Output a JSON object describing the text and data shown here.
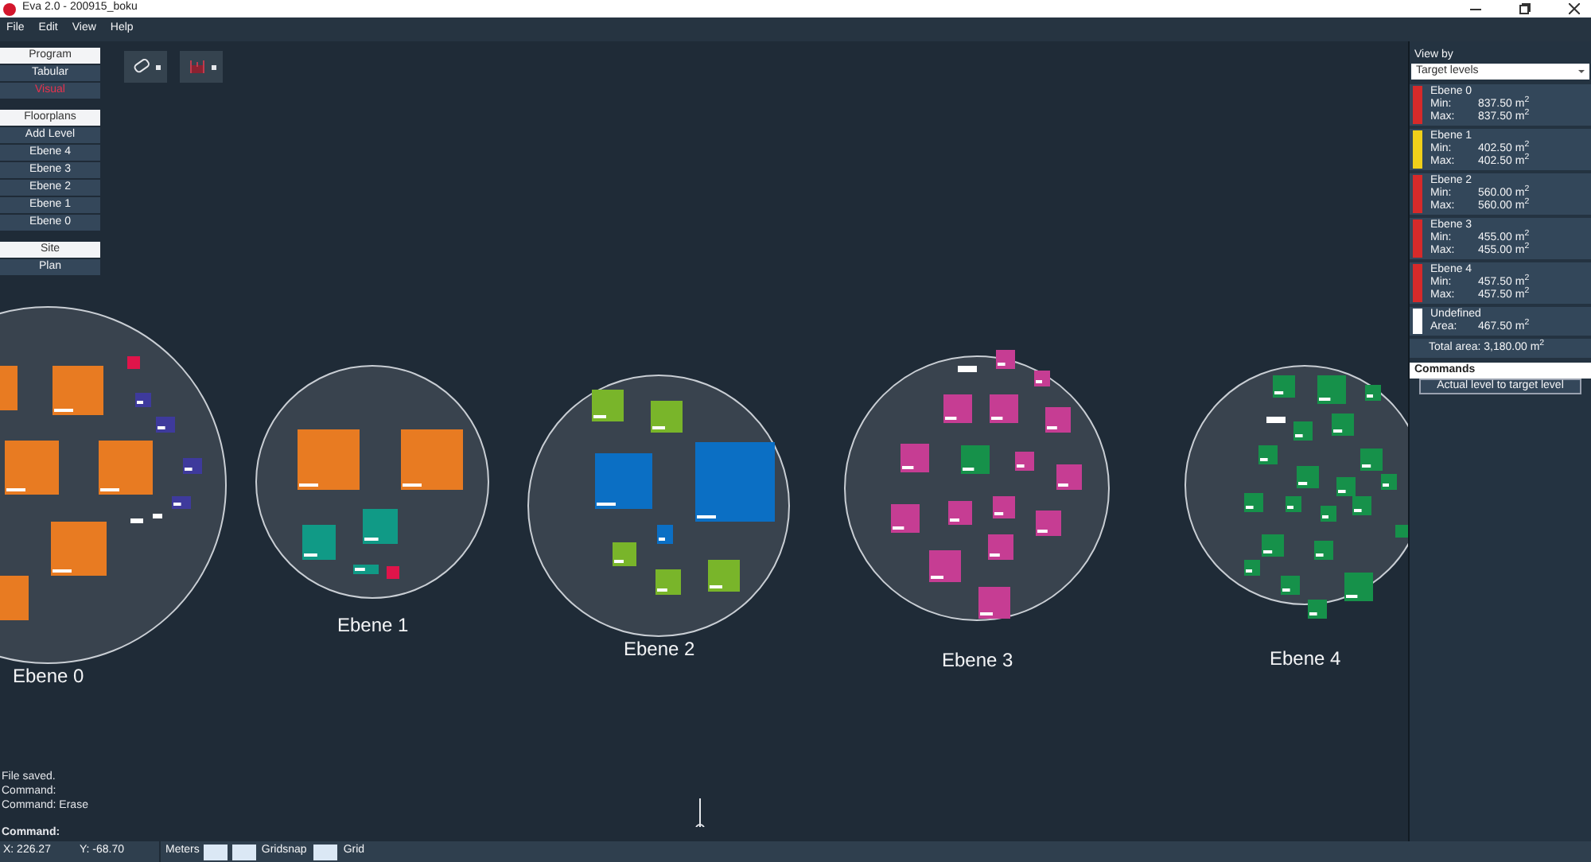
{
  "window": {
    "title": "Eva 2.0 - 200915_boku"
  },
  "menu": [
    "File",
    "Edit",
    "View",
    "Help"
  ],
  "left_panel": {
    "sections": [
      {
        "title": "Program",
        "items": [
          {
            "label": "Tabular",
            "selected": false
          },
          {
            "label": "Visual",
            "selected": true
          }
        ]
      },
      {
        "title": "Floorplans",
        "items": [
          {
            "label": "Add Level",
            "selected": false
          },
          {
            "label": "Ebene 4",
            "selected": false
          },
          {
            "label": "Ebene 3",
            "selected": false
          },
          {
            "label": "Ebene 2",
            "selected": false
          },
          {
            "label": "Ebene 1",
            "selected": false
          },
          {
            "label": "Ebene 0",
            "selected": false
          }
        ]
      },
      {
        "title": "Site",
        "items": [
          {
            "label": "Plan",
            "selected": false
          }
        ]
      }
    ]
  },
  "canvas": {
    "levels": [
      {
        "name": "Ebene 0"
      },
      {
        "name": "Ebene 1"
      },
      {
        "name": "Ebene 2"
      },
      {
        "name": "Ebene 3"
      },
      {
        "name": "Ebene 4"
      }
    ]
  },
  "log": [
    "File saved.",
    "Command:",
    "Command: Erase"
  ],
  "command_prompt": "Command:",
  "right_panel": {
    "view_by_label": "View by",
    "view_by_value": "Target levels",
    "levels": [
      {
        "name": "Ebene 0",
        "color": "#d62a2a",
        "rows": [
          {
            "label": "Min:",
            "value": "837.50 m$^{2}$"
          },
          {
            "label": "Max:",
            "value": "837.50 m$^{2}$"
          }
        ]
      },
      {
        "name": "Ebene 1",
        "color": "#f0d01a",
        "rows": [
          {
            "label": "Min:",
            "value": "402.50 m$^{2}$"
          },
          {
            "label": "Max:",
            "value": "402.50 m$^{2}$"
          }
        ]
      },
      {
        "name": "Ebene 2",
        "color": "#d62a2a",
        "rows": [
          {
            "label": "Min:",
            "value": "560.00 m$^{2}$"
          },
          {
            "label": "Max:",
            "value": "560.00 m$^{2}$"
          }
        ]
      },
      {
        "name": "Ebene 3",
        "color": "#d62a2a",
        "rows": [
          {
            "label": "Min:",
            "value": "455.00 m$^{2}$"
          },
          {
            "label": "Max:",
            "value": "455.00 m$^{2}$"
          }
        ]
      },
      {
        "name": "Ebene 4",
        "color": "#d62a2a",
        "rows": [
          {
            "label": "Min:",
            "value": "457.50 m$^{2}$"
          },
          {
            "label": "Max:",
            "value": "457.50 m$^{2}$"
          }
        ]
      },
      {
        "name": "Undefined",
        "color": "#ffffff",
        "rows": [
          {
            "label": "Area:",
            "value": "467.50 m$^{2}$"
          }
        ]
      }
    ],
    "total": "Total area:  3,180.00 m$^{2}$",
    "commands_label": "Commands",
    "command_button": "Actual level to target level"
  },
  "status_bar": {
    "x": "X:  226.27",
    "y": "Y:  -68.70",
    "units": "Meters",
    "gridsnap": "Gridsnap",
    "grid": "Grid"
  }
}
